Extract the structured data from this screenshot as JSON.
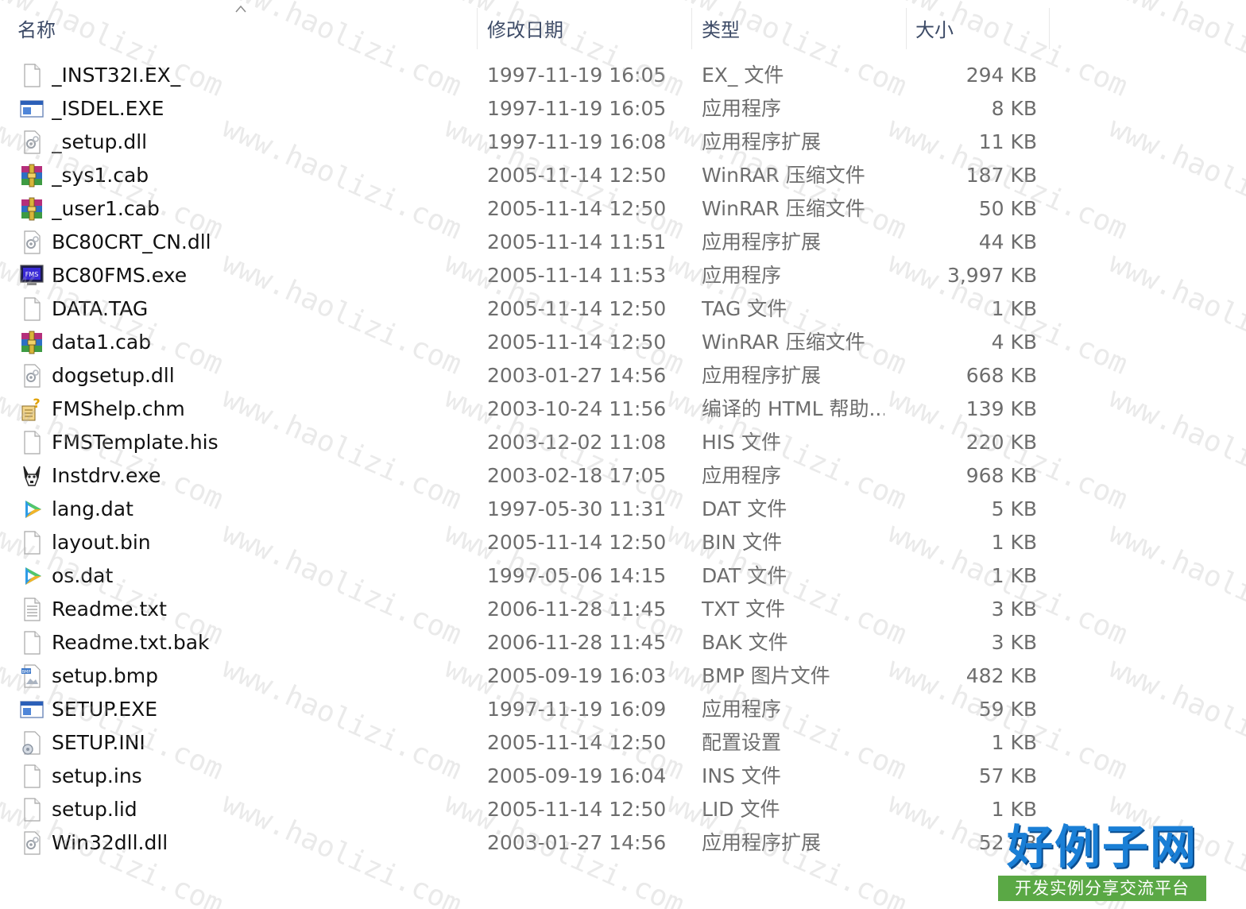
{
  "columns": {
    "name": "名称",
    "date": "修改日期",
    "type": "类型",
    "size": "大小"
  },
  "files": [
    {
      "name": "_INST32I.EX_",
      "date": "1997-11-19 16:05",
      "type": "EX_ 文件",
      "size": "294 KB",
      "icon": "blank-file"
    },
    {
      "name": "_ISDEL.EXE",
      "date": "1997-11-19 16:05",
      "type": "应用程序",
      "size": "8 KB",
      "icon": "app-window"
    },
    {
      "name": "_setup.dll",
      "date": "1997-11-19 16:08",
      "type": "应用程序扩展",
      "size": "11 KB",
      "icon": "dll-gear"
    },
    {
      "name": "_sys1.cab",
      "date": "2005-11-14 12:50",
      "type": "WinRAR 压缩文件",
      "size": "187 KB",
      "icon": "winrar"
    },
    {
      "name": "_user1.cab",
      "date": "2005-11-14 12:50",
      "type": "WinRAR 压缩文件",
      "size": "50 KB",
      "icon": "winrar"
    },
    {
      "name": "BC80CRT_CN.dll",
      "date": "2005-11-14 11:51",
      "type": "应用程序扩展",
      "size": "44 KB",
      "icon": "dll-gear"
    },
    {
      "name": "BC80FMS.exe",
      "date": "2005-11-14 11:53",
      "type": "应用程序",
      "size": "3,997 KB",
      "icon": "fms-monitor"
    },
    {
      "name": "DATA.TAG",
      "date": "2005-11-14 12:50",
      "type": "TAG 文件",
      "size": "1 KB",
      "icon": "blank-file"
    },
    {
      "name": "data1.cab",
      "date": "2005-11-14 12:50",
      "type": "WinRAR 压缩文件",
      "size": "4 KB",
      "icon": "winrar"
    },
    {
      "name": "dogsetup.dll",
      "date": "2003-01-27 14:56",
      "type": "应用程序扩展",
      "size": "668 KB",
      "icon": "dll-gear"
    },
    {
      "name": "FMShelp.chm",
      "date": "2003-10-24 11:56",
      "type": "编译的 HTML 帮助...",
      "size": "139 KB",
      "icon": "chm-help"
    },
    {
      "name": "FMSTemplate.his",
      "date": "2003-12-02 11:08",
      "type": "HIS 文件",
      "size": "220 KB",
      "icon": "blank-file"
    },
    {
      "name": "Instdrv.exe",
      "date": "2003-02-18 17:05",
      "type": "应用程序",
      "size": "968 KB",
      "icon": "dog-app"
    },
    {
      "name": "lang.dat",
      "date": "1997-05-30 11:31",
      "type": "DAT 文件",
      "size": "5 KB",
      "icon": "play-media"
    },
    {
      "name": "layout.bin",
      "date": "2005-11-14 12:50",
      "type": "BIN 文件",
      "size": "1 KB",
      "icon": "blank-file"
    },
    {
      "name": "os.dat",
      "date": "1997-05-06 14:15",
      "type": "DAT 文件",
      "size": "1 KB",
      "icon": "play-media"
    },
    {
      "name": "Readme.txt",
      "date": "2006-11-28 11:45",
      "type": "TXT 文件",
      "size": "3 KB",
      "icon": "text-file"
    },
    {
      "name": "Readme.txt.bak",
      "date": "2006-11-28 11:45",
      "type": "BAK 文件",
      "size": "3 KB",
      "icon": "blank-file"
    },
    {
      "name": "setup.bmp",
      "date": "2005-09-19 16:03",
      "type": "BMP 图片文件",
      "size": "482 KB",
      "icon": "bmp-image"
    },
    {
      "name": "SETUP.EXE",
      "date": "1997-11-19 16:09",
      "type": "应用程序",
      "size": "59 KB",
      "icon": "app-window"
    },
    {
      "name": "SETUP.INI",
      "date": "2005-11-14 12:50",
      "type": "配置设置",
      "size": "1 KB",
      "icon": "ini-gear"
    },
    {
      "name": "setup.ins",
      "date": "2005-09-19 16:04",
      "type": "INS 文件",
      "size": "57 KB",
      "icon": "blank-file"
    },
    {
      "name": "setup.lid",
      "date": "2005-11-14 12:50",
      "type": "LID 文件",
      "size": "1 KB",
      "icon": "blank-file"
    },
    {
      "name": "Win32dll.dll",
      "date": "2003-01-27 14:56",
      "type": "应用程序扩展",
      "size": "52 KB",
      "icon": "dll-gear"
    }
  ],
  "watermark": {
    "text": "www.haolizi.com"
  },
  "brand": {
    "title": "好例子网",
    "subtitle": "开发实例分享交流平台"
  },
  "colors": {
    "header_text": "#3c4a66",
    "secondary_text": "#6d6d6d",
    "brand_blue": "#1a7fd6",
    "brand_green": "#5aa845"
  }
}
